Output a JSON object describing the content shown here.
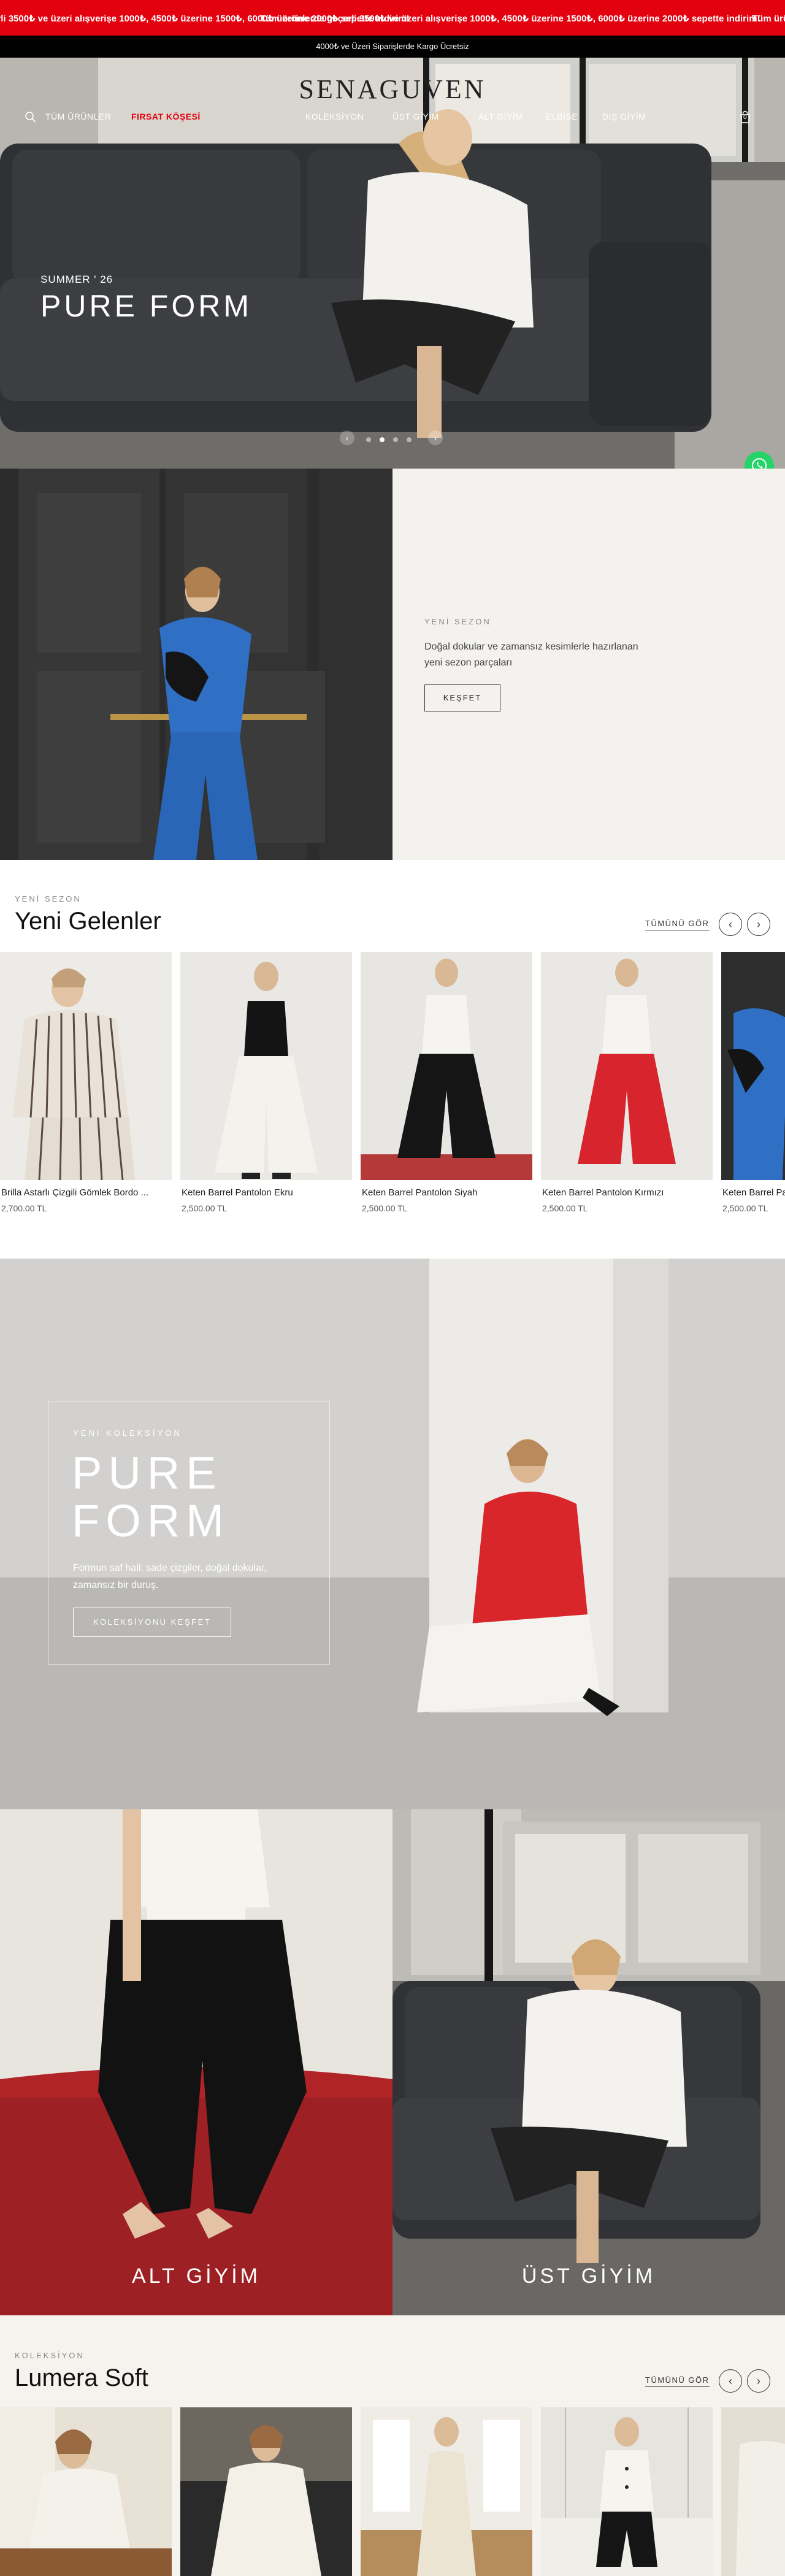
{
  "promo": {
    "items": [
      "Tüm ürünlerde geçerli 3500₺ ve üzeri alışverişe 1000₺, 4500₺ üzerine 1500₺, 6000₺ üzerine 2000₺ sepette indirim!",
      "Tüm ürünlerde geçerli 3500₺ ve üzeri alışverişe 1000₺, 4500₺ üzerine 1500₺, 6000₺ üzerine 2000₺ sepette indirim!",
      "Tüm ürünlerde geçerli 3500₺ ve üzeri alışverişe 1000₺, 4500₺ üzerine 1500₺, 6000₺ üzerine 2000₺ sepette indirim!"
    ],
    "bg_color": "#e3000f"
  },
  "shipping_bar": {
    "text": "4000₺ ve Üzeri Siparişlerde Kargo Ücretsiz"
  },
  "header": {
    "logo": "SENAGUVEN",
    "nav": [
      "TÜM ÜRÜNLER",
      "FIRSAT KÖŞESİ",
      "KOLEKSİYON",
      "ÜST GİYİM",
      "ALT GİYİM",
      "ELBİSE",
      "DIŞ GİYİM"
    ],
    "cart_count": "0",
    "search_icon": "search-icon",
    "cart_icon": "bag-icon"
  },
  "hero": {
    "season": "SUMMER ' 26",
    "title": "PURE FORM",
    "prev": "‹",
    "next": "›"
  },
  "new_season": {
    "label": "YENİ SEZON",
    "description": "Doğal dokular ve zamansız kesimlerle hazırlanan yeni sezon parçaları",
    "button": "KEŞFET"
  },
  "new_arrivals": {
    "label": "YENİ SEZON",
    "title": "Yeni Gelenler",
    "see_all": "TÜMÜNÜ GÖR",
    "prev": "‹",
    "next": "›",
    "products": [
      {
        "name": "Brilla Astarlı Çizgili Gömlek Bordo ...",
        "price": "2,700.00 TL"
      },
      {
        "name": "Keten Barrel Pantolon Ekru",
        "price": "2,500.00 TL"
      },
      {
        "name": "Keten Barrel Pantolon Siyah",
        "price": "2,500.00 TL"
      },
      {
        "name": "Keten Barrel Pantolon Kırmızı",
        "price": "2,500.00 TL"
      },
      {
        "name": "Keten Barrel Pantolon Mavi",
        "price": "2,500.00 TL"
      }
    ]
  },
  "collection_banner": {
    "label": "YENİ KOLEKSİYON",
    "title": "PURE FORM",
    "description": "Formun saf hali: sade çizgiler, doğal dokular, zamansız bir duruş.",
    "button": "KOLEKSİYONU KEŞFET"
  },
  "categories": [
    {
      "label": "ALT GİYİM"
    },
    {
      "label": "ÜST GİYİM"
    }
  ],
  "lumera": {
    "label": "KOLEKSİYON",
    "title": "Lumera Soft",
    "see_all": "TÜMÜNÜ GÖR",
    "prev": "‹",
    "next": "›"
  },
  "colors": {
    "accent_red": "#e3000f",
    "whatsapp": "#25d366",
    "cream": "#f4f2ee"
  }
}
